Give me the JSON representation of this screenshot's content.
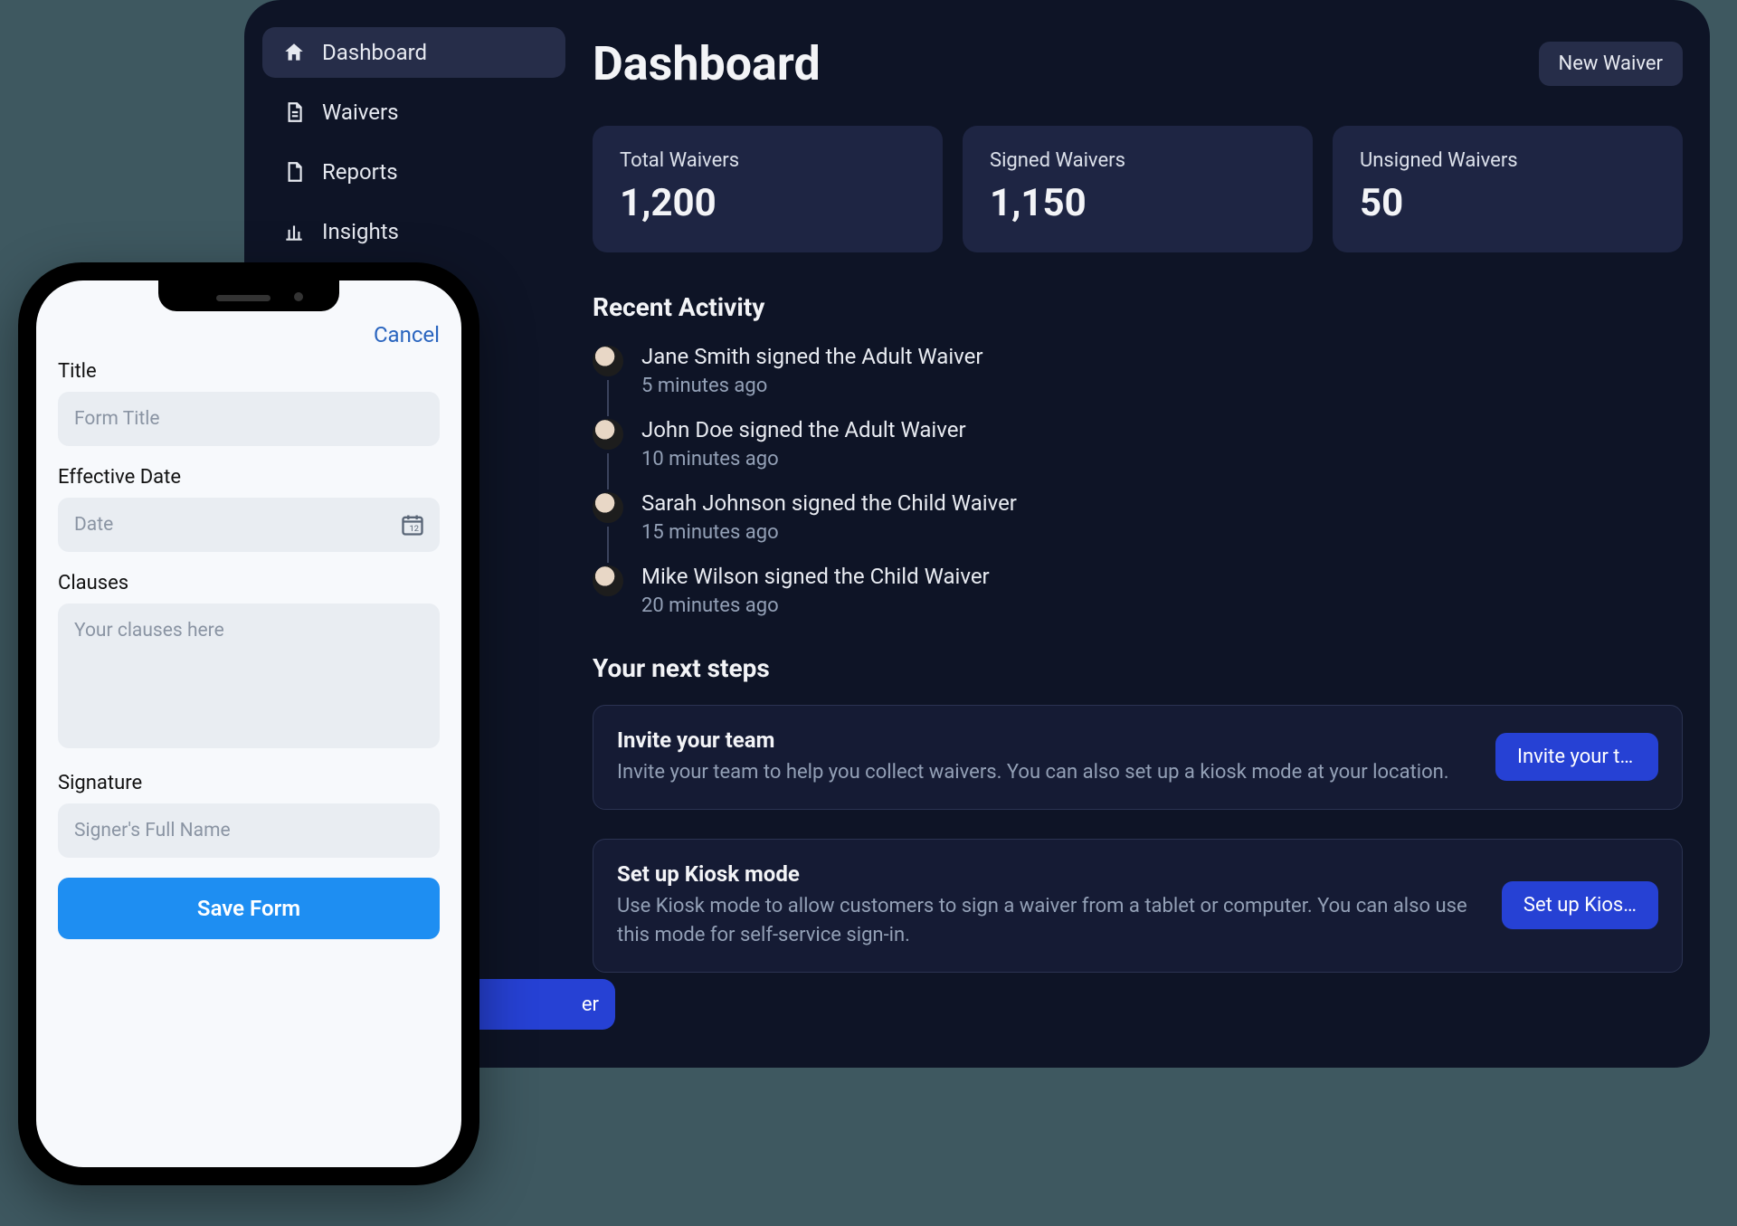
{
  "sidebar": {
    "items": [
      {
        "label": "Dashboard"
      },
      {
        "label": "Waivers"
      },
      {
        "label": "Reports"
      },
      {
        "label": "Insights"
      }
    ]
  },
  "header": {
    "title": "Dashboard",
    "new_waiver": "New Waiver"
  },
  "stats": [
    {
      "label": "Total Waivers",
      "value": "1,200"
    },
    {
      "label": "Signed Waivers",
      "value": "1,150"
    },
    {
      "label": "Unsigned Waivers",
      "value": "50"
    }
  ],
  "recent": {
    "title": "Recent Activity",
    "items": [
      {
        "text": "Jane Smith signed the Adult Waiver",
        "time": "5 minutes ago"
      },
      {
        "text": "John Doe signed the Adult Waiver",
        "time": "10 minutes ago"
      },
      {
        "text": "Sarah Johnson signed the Child Waiver",
        "time": "15 minutes ago"
      },
      {
        "text": "Mike Wilson signed the Child Waiver",
        "time": "20 minutes ago"
      }
    ]
  },
  "next": {
    "title": "Your next steps",
    "steps": [
      {
        "title": "Invite your team",
        "desc": "Invite your team to help you collect waivers. You can also set up a kiosk mode at your location.",
        "button": "Invite your team"
      },
      {
        "title": "Set up Kiosk mode",
        "desc": "Use Kiosk mode to allow customers to sign a waiver from a tablet or computer. You can also use this mode for self-service sign-in.",
        "button": "Set up Kios…"
      }
    ]
  },
  "peek_button": "er",
  "phone": {
    "cancel": "Cancel",
    "title": {
      "label": "Title",
      "placeholder": "Form Title"
    },
    "date": {
      "label": "Effective Date",
      "placeholder": "Date"
    },
    "clauses": {
      "label": "Clauses",
      "placeholder": "Your clauses here"
    },
    "signature": {
      "label": "Signature",
      "placeholder": "Signer's Full Name"
    },
    "save": "Save Form"
  }
}
